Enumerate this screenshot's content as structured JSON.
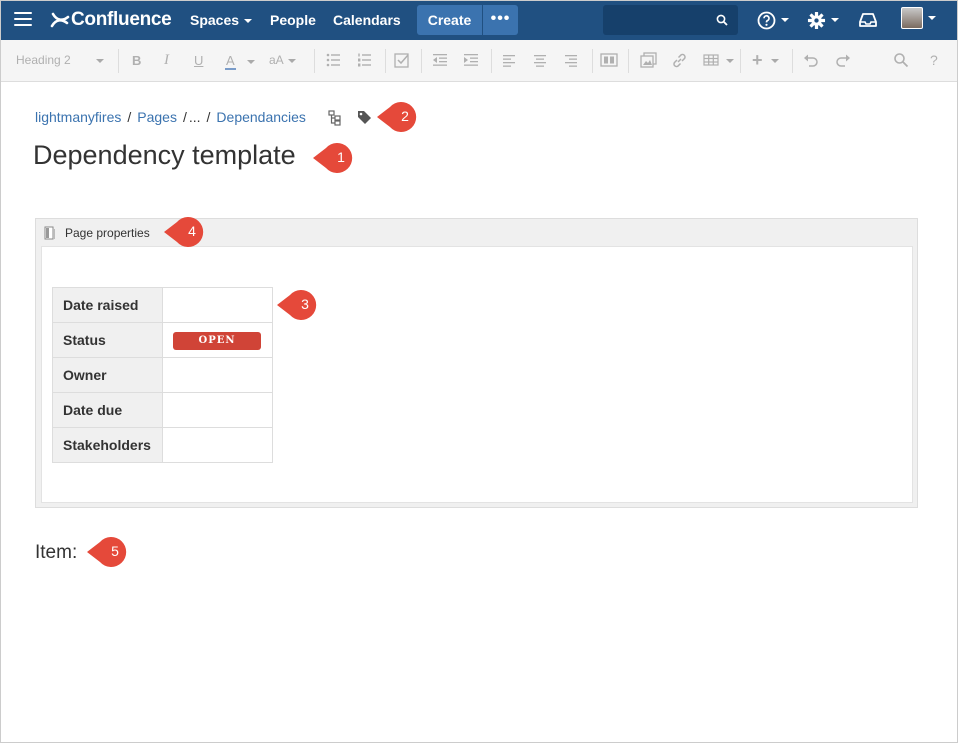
{
  "nav": {
    "logo": "Confluence",
    "spaces": "Spaces",
    "people": "People",
    "calendars": "Calendars",
    "create": "Create",
    "more": "•••"
  },
  "toolbar": {
    "style_label": "Heading 2"
  },
  "breadcrumb": [
    "lightmanyfires",
    "Pages",
    "...",
    "Dependancies"
  ],
  "page": {
    "title": "Dependency template"
  },
  "macro": {
    "title": "Page properties"
  },
  "properties": [
    {
      "key": "Date raised",
      "value": ""
    },
    {
      "key": "Status",
      "value": "OPEN"
    },
    {
      "key": "Owner",
      "value": ""
    },
    {
      "key": "Date due",
      "value": ""
    },
    {
      "key": "Stakeholders",
      "value": ""
    }
  ],
  "item_heading": "Item:",
  "callouts": [
    "1",
    "2",
    "3",
    "4",
    "5"
  ],
  "colors": {
    "nav": "#205081",
    "accent": "#3b73af",
    "status_open": "#d04437",
    "callout": "#e5493a"
  }
}
